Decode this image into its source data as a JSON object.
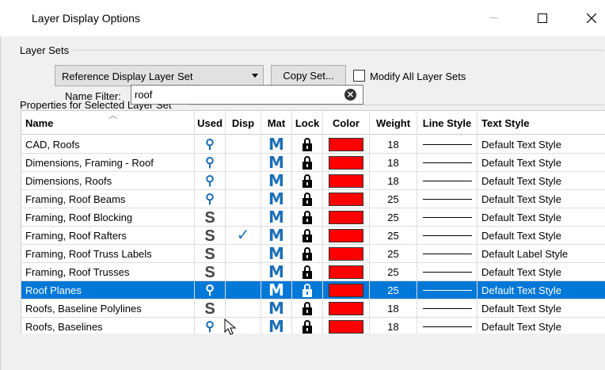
{
  "window": {
    "title": "Layer Display Options",
    "min_icon": "minimize-icon",
    "max_icon": "maximize-icon",
    "close_icon": "close-icon"
  },
  "layer_sets": {
    "group_label": "Layer Sets",
    "selected_set": "Reference Display Layer Set",
    "copy_button": "Copy Set...",
    "modify_all_label": "Modify All Layer Sets",
    "modify_all_checked": false
  },
  "properties": {
    "group_label": "Properties for Selected Layer Set",
    "name_filter_label": "Name Filter:",
    "name_filter_value": "roof"
  },
  "table": {
    "headers": {
      "name": "Name",
      "used": "Used",
      "disp": "Disp",
      "mat": "Mat",
      "lock": "Lock",
      "color": "Color",
      "weight": "Weight",
      "line_style": "Line Style",
      "text_style": "Text Style"
    },
    "selected_row": 8,
    "rows": [
      {
        "name": "CAD, Roofs",
        "used": "wrench",
        "disp": false,
        "mat": "M",
        "lock": true,
        "color": "#ff0000",
        "weight": "18",
        "text_style": "Default Text Style"
      },
      {
        "name": "Dimensions, Framing - Roof",
        "used": "wrench",
        "disp": false,
        "mat": "M",
        "lock": true,
        "color": "#ff0000",
        "weight": "18",
        "text_style": "Default Text Style"
      },
      {
        "name": "Dimensions, Roofs",
        "used": "wrench",
        "disp": false,
        "mat": "M",
        "lock": true,
        "color": "#ff0000",
        "weight": "18",
        "text_style": "Default Text Style"
      },
      {
        "name": "Framing, Roof Beams",
        "used": "wrench",
        "disp": false,
        "mat": "M",
        "lock": true,
        "color": "#ff0000",
        "weight": "25",
        "text_style": "Default Text Style"
      },
      {
        "name": "Framing, Roof Blocking",
        "used": "S",
        "disp": false,
        "mat": "M",
        "lock": true,
        "color": "#ff0000",
        "weight": "25",
        "text_style": "Default Text Style"
      },
      {
        "name": "Framing, Roof Rafters",
        "used": "S",
        "disp": true,
        "mat": "M",
        "lock": true,
        "color": "#ff0000",
        "weight": "25",
        "text_style": "Default Text Style"
      },
      {
        "name": "Framing, Roof Truss Labels",
        "used": "S",
        "disp": false,
        "mat": "M",
        "lock": true,
        "color": "#ff0000",
        "weight": "25",
        "text_style": "Default Label Style"
      },
      {
        "name": "Framing, Roof Trusses",
        "used": "S",
        "disp": false,
        "mat": "M",
        "lock": true,
        "color": "#ff0000",
        "weight": "25",
        "text_style": "Default Text Style"
      },
      {
        "name": "Roof Planes",
        "used": "wrench",
        "disp": false,
        "mat": "M",
        "lock": true,
        "color": "#ff0000",
        "weight": "25",
        "text_style": "Default Text Style"
      },
      {
        "name": "Roofs, Baseline Polylines",
        "used": "S",
        "disp": false,
        "mat": "M",
        "lock": true,
        "color": "#ff0000",
        "weight": "18",
        "text_style": "Default Text Style"
      },
      {
        "name": "Roofs, Baselines",
        "used": "wrench",
        "disp": false,
        "mat": "M",
        "lock": true,
        "color": "#ff0000",
        "weight": "18",
        "text_style": "Default Text Style"
      }
    ]
  },
  "icons": {
    "check": "✓",
    "clear": "✕"
  }
}
